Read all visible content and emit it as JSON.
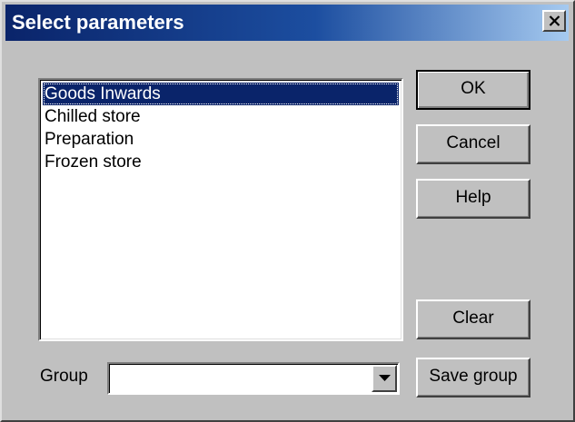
{
  "window": {
    "title": "Select parameters"
  },
  "parameters": {
    "items": [
      {
        "label": "Goods Inwards",
        "selected": true
      },
      {
        "label": "Chilled store",
        "selected": false
      },
      {
        "label": "Preparation",
        "selected": false
      },
      {
        "label": "Frozen store",
        "selected": false
      }
    ]
  },
  "buttons": {
    "ok": "OK",
    "cancel": "Cancel",
    "help": "Help",
    "clear": "Clear",
    "save_group": "Save group"
  },
  "group": {
    "label": "Group",
    "value": ""
  },
  "icons": {
    "close": "close-icon",
    "dropdown": "chevron-down-icon"
  },
  "colors": {
    "titlebar_start": "#0a246a",
    "titlebar_end": "#a6caf0",
    "selection": "#0a246a",
    "face": "#c0c0c0"
  }
}
